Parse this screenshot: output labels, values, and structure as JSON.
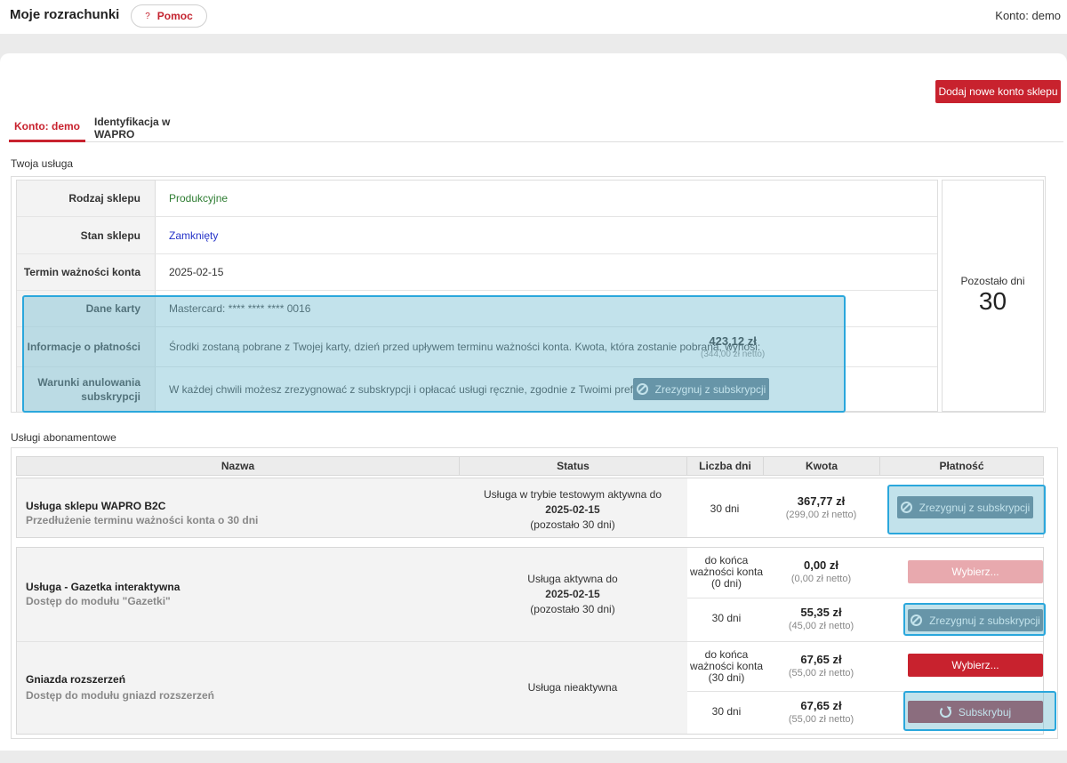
{
  "header": {
    "title": "Moje rozrachunki",
    "help_label": "Pomoc",
    "help_icon": "?",
    "account_label": "Konto: demo"
  },
  "actions": {
    "add_shop_label": "Dodaj nowe konto sklepu"
  },
  "tabs": [
    {
      "label": "Konto: demo",
      "active": true
    },
    {
      "label": "Identyfikacja w WAPRO",
      "active": false
    }
  ],
  "service": {
    "section_title": "Twoja usługa",
    "rows": [
      {
        "label": "Rodzaj sklepu",
        "value": "Produkcyjne"
      },
      {
        "label": "Stan sklepu",
        "value": "Zamknięty"
      },
      {
        "label": "Termin ważności konta",
        "value": "2025-02-15"
      },
      {
        "label": "Dane karty",
        "value": "Mastercard: **** **** **** 0016"
      },
      {
        "label": "Informacje o płatności",
        "value": "Środki zostaną pobrane z Twojej karty, dzień przed upływem terminu ważności konta. Kwota, która zostanie pobrana, wynosi:",
        "amount": "423,12 zł",
        "amount_net": "(344,00 zł netto)"
      },
      {
        "label": "Warunki anulowania subskrypcji",
        "value": "W każdej chwili możesz zrezygnować z subskrypcji i opłacać usługi ręcznie, zgodnie z Twoimi preferencjami.",
        "button": "Zrezygnuj z subskrypcji"
      }
    ],
    "days_left_label": "Pozostało dni",
    "days_left_value": "30"
  },
  "subscriptions": {
    "section_title": "Usługi abonamentowe",
    "columns": [
      "Nazwa",
      "Status",
      "Liczba dni",
      "Kwota",
      "Płatność"
    ],
    "items": [
      {
        "name": "Usługa sklepu WAPRO B2C",
        "desc": "Przedłużenie terminu ważności konta o 30 dni",
        "status_line1": "Usługa w trybie testowym aktywna do",
        "status_date": "2025-02-15",
        "status_line3": "(pozostało 30 dni)",
        "options": [
          {
            "days": "30 dni",
            "amount": "367,77 zł",
            "amount_net": "(299,00 zł netto)",
            "action": "Zrezygnuj z subskrypcji"
          }
        ]
      },
      {
        "name": "Usługa - Gazetka interaktywna",
        "desc": "Dostęp do modułu \"Gazetki\"",
        "status_line1": "Usługa aktywna do",
        "status_date": "2025-02-15",
        "status_line3": "(pozostało 30 dni)",
        "options": [
          {
            "days": "do końca ważności konta (0 dni)",
            "amount": "0,00 zł",
            "amount_net": "(0,00 zł netto)",
            "action": "Wybierz..."
          },
          {
            "days": "30 dni",
            "amount": "55,35 zł",
            "amount_net": "(45,00 zł netto)",
            "action": "Zrezygnuj z subskrypcji"
          }
        ]
      },
      {
        "name": "Gniazda rozszerzeń",
        "desc": "Dostęp do modułu gniazd rozszerzeń",
        "status_line1": "Usługa nieaktywna",
        "options": [
          {
            "days": "do końca ważności konta (30 dni)",
            "amount": "67,65 zł",
            "amount_net": "(55,00 zł netto)",
            "action": "Wybierz..."
          },
          {
            "days": "30 dni",
            "amount": "67,65 zł",
            "amount_net": "(55,00 zł netto)",
            "action": "Subskrybuj"
          }
        ]
      }
    ]
  },
  "colors": {
    "brand_red": "#c8222e",
    "button_slate": "#5a7485",
    "button_disabled": "#e8a9ae",
    "subscribe_maroon": "#9b2a3a",
    "highlight_blue": "#2aa7dc"
  }
}
